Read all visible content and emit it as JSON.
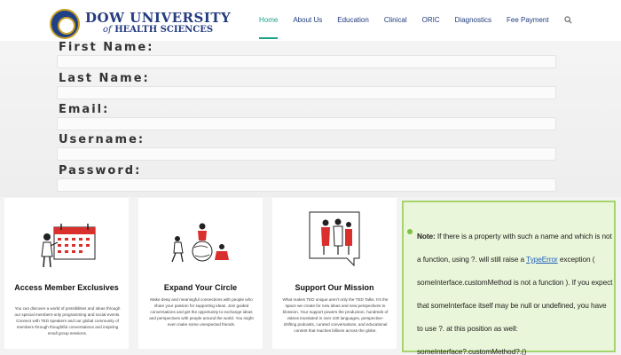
{
  "logo": {
    "line1": "DOW UNIVERSITY",
    "line2_prefix": "of",
    "line2_rest": "HEALTH SCIENCES"
  },
  "nav": {
    "items": [
      {
        "label": "Home",
        "active": true
      },
      {
        "label": "About Us"
      },
      {
        "label": "Education"
      },
      {
        "label": "Clinical"
      },
      {
        "label": "ORIC"
      },
      {
        "label": "Diagnostics"
      },
      {
        "label": "Fee Payment"
      }
    ],
    "search_icon": "search-icon"
  },
  "form": {
    "first_name": "First Name:",
    "last_name": "Last Name:",
    "email": "Email:",
    "username": "Username:",
    "password": "Password:"
  },
  "cards": [
    {
      "title": "Access Member Exclusives",
      "text": "You can discover a world of possibilities and ideas through our special members-only programming and social events. Connect with TED speakers and our global community of members through thoughtful conversations and inspiring small group sessions.",
      "icon": "calendar-person-illustration"
    },
    {
      "title": "Expand Your Circle",
      "text": "Make deep and meaningful connections with people who share your passion for supporting ideas. Join guided conversations and get the opportunity to exchange ideas and perspectives with people around the world. You might even make some unexpected friends.",
      "icon": "people-globe-illustration"
    },
    {
      "title": "Support Our Mission",
      "text": "What makes TED unique aren't only the TED Talks. It's the space we create for new ideas and new perspectives to blossom. Your support powers the production, hundreds of videos translated in over 100 languages, perspective-shifting podcasts, curated conversations, and educational content that reaches billions across the globe.",
      "icon": "speech-bubble-people-illustration"
    }
  ],
  "note": {
    "label": "Note:",
    "part1": " If there is a property with such a name and which is not a function, using ?. will still raise a ",
    "link": "TypeError",
    "part2": " exception ( someInterface.customMethod is not a function ). If you expect that someInterface itself may be null or undefined, you have to use ?. at this position as well: someInterface?.customMethod?.()"
  },
  "colors": {
    "accent": "#1aa387",
    "nav_text": "#1f3a7a",
    "brand": "#243c7f",
    "note_border": "#a6d46c",
    "note_bg": "#eaf6d9",
    "calendar_red": "#d9302e"
  }
}
